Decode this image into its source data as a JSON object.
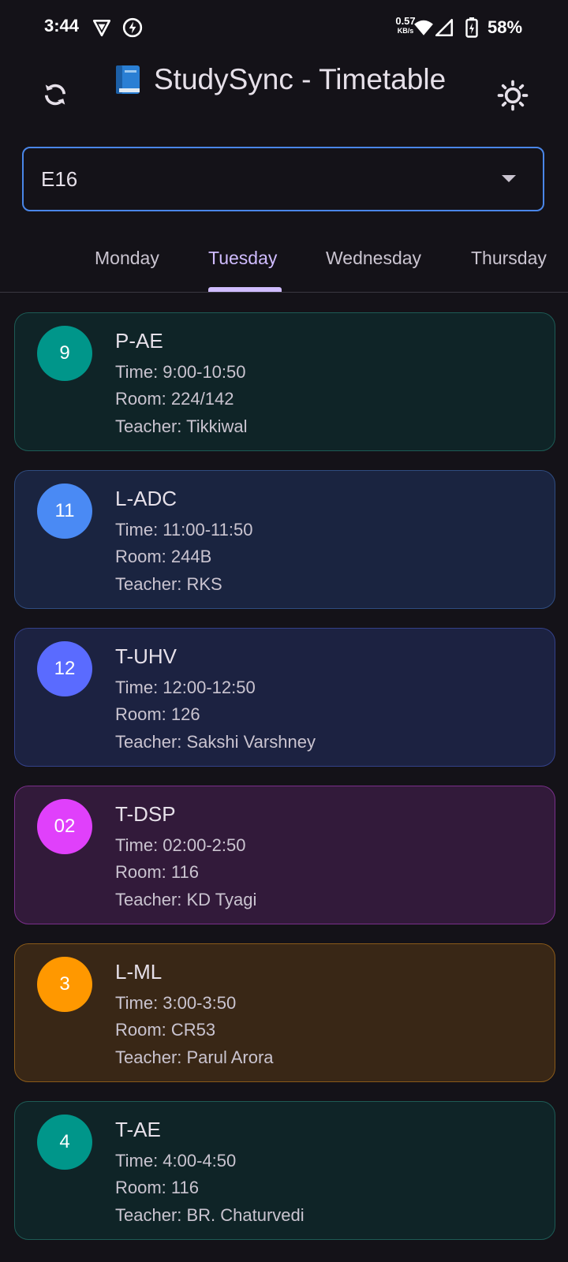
{
  "status_bar": {
    "time": "3:44",
    "net_speed_value": "0.57",
    "net_speed_unit": "KB/s",
    "battery_percent": "58%"
  },
  "app_bar": {
    "title": "StudySync - Timetable",
    "title_icon": "blue-book-icon",
    "left_action_icon": "refresh-icon",
    "right_action_icon": "sun-icon"
  },
  "class_selector": {
    "value": "E16"
  },
  "tabs": [
    {
      "label": "Monday",
      "active": false
    },
    {
      "label": "Tuesday",
      "active": true
    },
    {
      "label": "Wednesday",
      "active": false
    },
    {
      "label": "Thursday",
      "active": false
    }
  ],
  "classes": [
    {
      "badge": "9",
      "subject": "P-AE",
      "time": "Time: 9:00-10:50",
      "room": "Room: 224/142",
      "teacher": "Teacher: Tikkiwal",
      "accent": "#00968a",
      "bg": "#0f2427",
      "border": "#1d5b55"
    },
    {
      "badge": "11",
      "subject": "L-ADC",
      "time": "Time: 11:00-11:50",
      "room": "Room: 244B",
      "teacher": "Teacher: RKS",
      "accent": "#4a8af4",
      "bg": "#1a2440",
      "border": "#2f4c80"
    },
    {
      "badge": "12",
      "subject": "T-UHV",
      "time": "Time: 12:00-12:50",
      "room": "Room: 126",
      "teacher": "Teacher: Sakshi Varshney",
      "accent": "#5a6bff",
      "bg": "#1c2241",
      "border": "#34418a"
    },
    {
      "badge": "02",
      "subject": "T-DSP",
      "time": "Time: 02:00-2:50",
      "room": "Room: 116",
      "teacher": "Teacher: KD Tyagi",
      "accent": "#e040fb",
      "bg": "#321a3a",
      "border": "#7a2f8a"
    },
    {
      "badge": "3",
      "subject": "L-ML",
      "time": "Time: 3:00-3:50",
      "room": "Room: CR53",
      "teacher": "Teacher: Parul Arora",
      "accent": "#ff9800",
      "bg": "#392716",
      "border": "#8a5a19"
    },
    {
      "badge": "4",
      "subject": "T-AE",
      "time": "Time: 4:00-4:50",
      "room": "Room: 116",
      "teacher": "Teacher: BR. Chaturvedi",
      "accent": "#00968a",
      "bg": "#0f2427",
      "border": "#1d5b55"
    }
  ]
}
